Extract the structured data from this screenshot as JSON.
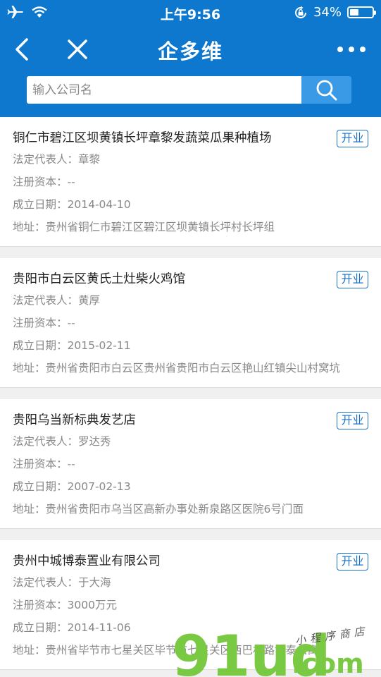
{
  "status": {
    "time": "上午9:56",
    "battery": "34%"
  },
  "nav": {
    "title": "企多维"
  },
  "search": {
    "placeholder": "输入公司名"
  },
  "labels": {
    "rep": "法定代表人：",
    "capital": "注册资本：",
    "date": "成立日期：",
    "addr": "地址："
  },
  "companies": [
    {
      "name": "铜仁市碧江区坝黄镇长坪章黎发蔬菜瓜果种植场",
      "status": "开业",
      "rep": "章黎",
      "capital": "--",
      "date": "2014-04-10",
      "addr": "贵州省铜仁市碧江区碧江区坝黄镇长坪村长坪组"
    },
    {
      "name": "贵阳市白云区黄氏土灶柴火鸡馆",
      "status": "开业",
      "rep": "黄厚",
      "capital": "--",
      "date": "2015-02-11",
      "addr": "贵州省贵阳市白云区贵州省贵阳市白云区艳山红镇尖山村窝坑"
    },
    {
      "name": "贵阳乌当新标典发艺店",
      "status": "开业",
      "rep": "罗达秀",
      "capital": "--",
      "date": "2007-02-13",
      "addr": "贵州省贵阳市乌当区高新办事处新泉路区医院6号门面"
    },
    {
      "name": "贵州中城博泰置业有限公司",
      "status": "开业",
      "rep": "于大海",
      "capital": "3000万元",
      "date": "2014-11-06",
      "addr": "贵州省毕节市七星关区毕节市七星关区西巴林路博泰公寓"
    }
  ],
  "watermark": {
    "brand": "91ud",
    "tld": ".com",
    "tagline": "小程序商店"
  },
  "colors": {
    "header": "#0e78cf",
    "search_button": "#3b9ae5",
    "badge": "#1a73c9",
    "watermark_green": "#7ac943"
  }
}
